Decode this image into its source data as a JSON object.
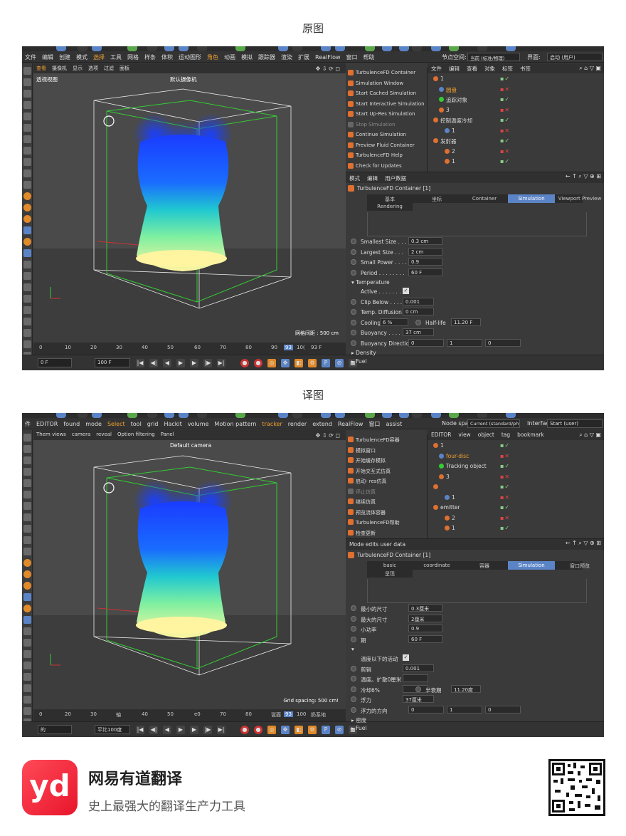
{
  "captions": {
    "original": "原图",
    "translated": "译图"
  },
  "colors": {
    "accent": "#5b84c7",
    "orange": "#e07030",
    "bg": "#3a3a3a"
  },
  "original": {
    "menubar": [
      "文件",
      "编辑",
      "创建",
      "模式",
      "选择",
      "工具",
      "网格",
      "样条",
      "体积",
      "运动图形",
      "角色",
      "动画",
      "模拟",
      "跟踪器",
      "渲染",
      "扩展",
      "RealFlow",
      "窗口",
      "帮助"
    ],
    "node_space_label": "节点空间:",
    "node_space_value": "当前 (标准/物理)",
    "interface_label": "界面:",
    "interface_value": "启动 (用户)",
    "viewport_menu": [
      "查看",
      "摄像机",
      "显示",
      "选项",
      "过滤",
      "面板"
    ],
    "viewport_name": "透视视图",
    "camera_name": "默认摄像机",
    "grid_spacing": "网格间距 : 500 cm",
    "timeline_ticks": [
      "0",
      "10",
      "20",
      "30",
      "40",
      "50",
      "60",
      "70",
      "80",
      "90",
      "93",
      "10(",
      "93 F"
    ],
    "playbar": {
      "start": "0 F",
      "end": "100 F"
    },
    "plugin_menu": [
      "TurbulenceFD Container",
      "Simulation Window",
      "Start Cached Simulation",
      "Start Interactive Simulation",
      "Start Up-Res Simulation",
      "Stop Simulation",
      "Continue Simulation",
      "Preview Fluid Container",
      "TurbulenceFD Help",
      "Check for Updates"
    ],
    "obj_menu": [
      "文件",
      "编辑",
      "查看",
      "对象",
      "标签",
      "书签"
    ],
    "objects": [
      {
        "name": "1",
        "indent": 0
      },
      {
        "name": "圆盘",
        "indent": 1
      },
      {
        "name": "追踪对象",
        "indent": 1
      },
      {
        "name": "3",
        "indent": 1
      },
      {
        "name": "控制温度冷却",
        "indent": 0
      },
      {
        "name": "1",
        "indent": 2
      },
      {
        "name": "发射器",
        "indent": 0
      },
      {
        "name": "2",
        "indent": 2
      },
      {
        "name": "1",
        "indent": 2
      }
    ],
    "attr_menu": [
      "模式",
      "编辑",
      "用户数据"
    ],
    "attr_title": "TurbulenceFD Container [1]",
    "tabs": [
      "基本",
      "坐标",
      "Container",
      "Simulation",
      "Viewport Preview"
    ],
    "tab2": "Rendering",
    "params": [
      {
        "label": "Smallest Size . . .",
        "value": "0.3 cm"
      },
      {
        "label": "Largest Size . . .",
        "value": "2 cm"
      },
      {
        "label": "Small Power . . . .",
        "value": "0.9"
      },
      {
        "label": "Period . . . . . . . .",
        "value": "60 F"
      }
    ],
    "temperature_section": "▾ Temperature",
    "temp_params": [
      {
        "label": "Active . . . . . . .",
        "type": "check"
      },
      {
        "label": "Clip Below . . . .",
        "value": "0.001"
      },
      {
        "label": "Temp. Diffusion",
        "value": "0 cm"
      },
      {
        "label": "Cooling",
        "value": "6 %",
        "label2": "Half-life",
        "value2": "11.20 F"
      },
      {
        "label": "Buoyancy . . . . . .",
        "value": "37 cm"
      },
      {
        "label": "Buoyancy Direction",
        "value": "0",
        "value2": "1",
        "value3": "0"
      }
    ],
    "density_section": "▸ Density",
    "fuel_section": "▸ Fuel"
  },
  "translated": {
    "menubar": [
      "件",
      "EDITOR",
      "found",
      "mode",
      "Select",
      "tool",
      "grid",
      "Hackit",
      "volume",
      "Motion pattern",
      "tracker",
      "render",
      "extend",
      "RealFlow",
      "窗口",
      "assist"
    ],
    "node_space_label": "Node space:",
    "node_space_value": "Current (standard/physics)",
    "interface_label": "Interface:",
    "interface_value": "Start (user)",
    "viewport_menu": [
      "Them views",
      "camera",
      "reveal",
      "Option filtering",
      "Panel"
    ],
    "camera_name": "Default camera",
    "grid_spacing": "Grid spacing: 500 cm!",
    "timeline_ticks": [
      "0",
      "20",
      "30",
      "轴",
      "40",
      "50",
      "e0",
      "70",
      "80",
      "诞面",
      "93",
      "100",
      "奶系地"
    ],
    "playbar": {
      "start": "的",
      "end": "平比100度"
    },
    "plugin_menu": [
      "TurbulenceFD容器",
      "模拟窗口",
      "开始缓存模拟",
      "开始交互式仿真",
      "启动- res仿真",
      "停止仿真",
      "继续仿真",
      "预览流体容器",
      "TurbulenceFD帮助",
      "检查更新"
    ],
    "obj_menu": [
      "EDITOR",
      "view",
      "object",
      "tag",
      "bookmark"
    ],
    "objects": [
      {
        "name": "1",
        "indent": 0
      },
      {
        "name": "four-disc",
        "indent": 1
      },
      {
        "name": "Tracking object",
        "indent": 1
      },
      {
        "name": "3",
        "indent": 1
      },
      {
        "name": "",
        "indent": 0
      },
      {
        "name": "1",
        "indent": 2
      },
      {
        "name": "emitter",
        "indent": 0
      },
      {
        "name": "2",
        "indent": 2
      },
      {
        "name": "1",
        "indent": 2
      }
    ],
    "attr_menu": [
      "Mode edits user data"
    ],
    "attr_title": "TurbulenceFD Container [1]",
    "tabs": [
      "basic",
      "coordinate",
      "容器",
      "Simulation",
      "窗口预览"
    ],
    "tab2": "呈现",
    "params": [
      {
        "label": "最小的尺寸",
        "value": "0.3厘米"
      },
      {
        "label": "最大的尺寸",
        "value": "2厘米"
      },
      {
        "label": "小功率",
        "value": "0.9"
      },
      {
        "label": "期",
        "value": "60 F"
      }
    ],
    "temperature_section": "▾",
    "temp_params": [
      {
        "label": "温度以下的活动",
        "type": "check"
      },
      {
        "label": "剪辑",
        "value": "0.001"
      },
      {
        "label": "温度。扩散0厘米",
        "value": ""
      },
      {
        "label": "冷却6%",
        "value": "",
        "label2": "半衰期",
        "value2": "11.20度"
      },
      {
        "label": "浮力",
        "value": "37厘米"
      },
      {
        "label": "浮力的方向",
        "value": "0",
        "value2": "1",
        "value3": "0"
      }
    ],
    "density_section": "▸ 密度",
    "fuel_section": "▸ Fuel"
  },
  "footer": {
    "logo_text": "yd",
    "brand": "网易有道翻译",
    "slogan": "史上最强大的翻译生产力工具"
  }
}
